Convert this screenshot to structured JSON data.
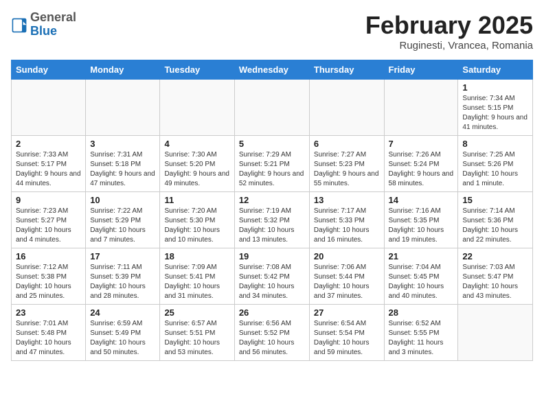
{
  "header": {
    "logo_general": "General",
    "logo_blue": "Blue",
    "month_title": "February 2025",
    "subtitle": "Ruginesti, Vrancea, Romania"
  },
  "days_of_week": [
    "Sunday",
    "Monday",
    "Tuesday",
    "Wednesday",
    "Thursday",
    "Friday",
    "Saturday"
  ],
  "weeks": [
    [
      {
        "day": "",
        "info": ""
      },
      {
        "day": "",
        "info": ""
      },
      {
        "day": "",
        "info": ""
      },
      {
        "day": "",
        "info": ""
      },
      {
        "day": "",
        "info": ""
      },
      {
        "day": "",
        "info": ""
      },
      {
        "day": "1",
        "info": "Sunrise: 7:34 AM\nSunset: 5:15 PM\nDaylight: 9 hours and 41 minutes."
      }
    ],
    [
      {
        "day": "2",
        "info": "Sunrise: 7:33 AM\nSunset: 5:17 PM\nDaylight: 9 hours and 44 minutes."
      },
      {
        "day": "3",
        "info": "Sunrise: 7:31 AM\nSunset: 5:18 PM\nDaylight: 9 hours and 47 minutes."
      },
      {
        "day": "4",
        "info": "Sunrise: 7:30 AM\nSunset: 5:20 PM\nDaylight: 9 hours and 49 minutes."
      },
      {
        "day": "5",
        "info": "Sunrise: 7:29 AM\nSunset: 5:21 PM\nDaylight: 9 hours and 52 minutes."
      },
      {
        "day": "6",
        "info": "Sunrise: 7:27 AM\nSunset: 5:23 PM\nDaylight: 9 hours and 55 minutes."
      },
      {
        "day": "7",
        "info": "Sunrise: 7:26 AM\nSunset: 5:24 PM\nDaylight: 9 hours and 58 minutes."
      },
      {
        "day": "8",
        "info": "Sunrise: 7:25 AM\nSunset: 5:26 PM\nDaylight: 10 hours and 1 minute."
      }
    ],
    [
      {
        "day": "9",
        "info": "Sunrise: 7:23 AM\nSunset: 5:27 PM\nDaylight: 10 hours and 4 minutes."
      },
      {
        "day": "10",
        "info": "Sunrise: 7:22 AM\nSunset: 5:29 PM\nDaylight: 10 hours and 7 minutes."
      },
      {
        "day": "11",
        "info": "Sunrise: 7:20 AM\nSunset: 5:30 PM\nDaylight: 10 hours and 10 minutes."
      },
      {
        "day": "12",
        "info": "Sunrise: 7:19 AM\nSunset: 5:32 PM\nDaylight: 10 hours and 13 minutes."
      },
      {
        "day": "13",
        "info": "Sunrise: 7:17 AM\nSunset: 5:33 PM\nDaylight: 10 hours and 16 minutes."
      },
      {
        "day": "14",
        "info": "Sunrise: 7:16 AM\nSunset: 5:35 PM\nDaylight: 10 hours and 19 minutes."
      },
      {
        "day": "15",
        "info": "Sunrise: 7:14 AM\nSunset: 5:36 PM\nDaylight: 10 hours and 22 minutes."
      }
    ],
    [
      {
        "day": "16",
        "info": "Sunrise: 7:12 AM\nSunset: 5:38 PM\nDaylight: 10 hours and 25 minutes."
      },
      {
        "day": "17",
        "info": "Sunrise: 7:11 AM\nSunset: 5:39 PM\nDaylight: 10 hours and 28 minutes."
      },
      {
        "day": "18",
        "info": "Sunrise: 7:09 AM\nSunset: 5:41 PM\nDaylight: 10 hours and 31 minutes."
      },
      {
        "day": "19",
        "info": "Sunrise: 7:08 AM\nSunset: 5:42 PM\nDaylight: 10 hours and 34 minutes."
      },
      {
        "day": "20",
        "info": "Sunrise: 7:06 AM\nSunset: 5:44 PM\nDaylight: 10 hours and 37 minutes."
      },
      {
        "day": "21",
        "info": "Sunrise: 7:04 AM\nSunset: 5:45 PM\nDaylight: 10 hours and 40 minutes."
      },
      {
        "day": "22",
        "info": "Sunrise: 7:03 AM\nSunset: 5:47 PM\nDaylight: 10 hours and 43 minutes."
      }
    ],
    [
      {
        "day": "23",
        "info": "Sunrise: 7:01 AM\nSunset: 5:48 PM\nDaylight: 10 hours and 47 minutes."
      },
      {
        "day": "24",
        "info": "Sunrise: 6:59 AM\nSunset: 5:49 PM\nDaylight: 10 hours and 50 minutes."
      },
      {
        "day": "25",
        "info": "Sunrise: 6:57 AM\nSunset: 5:51 PM\nDaylight: 10 hours and 53 minutes."
      },
      {
        "day": "26",
        "info": "Sunrise: 6:56 AM\nSunset: 5:52 PM\nDaylight: 10 hours and 56 minutes."
      },
      {
        "day": "27",
        "info": "Sunrise: 6:54 AM\nSunset: 5:54 PM\nDaylight: 10 hours and 59 minutes."
      },
      {
        "day": "28",
        "info": "Sunrise: 6:52 AM\nSunset: 5:55 PM\nDaylight: 11 hours and 3 minutes."
      },
      {
        "day": "",
        "info": ""
      }
    ]
  ]
}
